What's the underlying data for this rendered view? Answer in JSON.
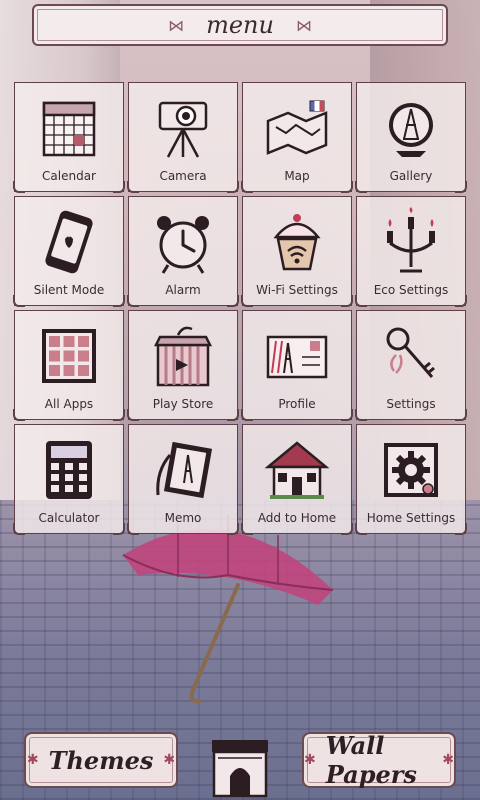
{
  "header": {
    "title": "menu",
    "left_icon": "bow-icon",
    "right_icon": "bow-icon"
  },
  "tiles": [
    {
      "label": "Calendar",
      "icon": "calendar-icon"
    },
    {
      "label": "Camera",
      "icon": "camera-icon"
    },
    {
      "label": "Map",
      "icon": "map-icon"
    },
    {
      "label": "Gallery",
      "icon": "gallery-icon"
    },
    {
      "label": "Silent Mode",
      "icon": "phone-icon"
    },
    {
      "label": "Alarm",
      "icon": "alarm-clock-icon"
    },
    {
      "label": "Wi-Fi Settings",
      "icon": "cupcake-wifi-icon"
    },
    {
      "label": "Eco Settings",
      "icon": "candelabra-icon"
    },
    {
      "label": "All Apps",
      "icon": "grid-icon"
    },
    {
      "label": "Play Store",
      "icon": "gift-box-icon"
    },
    {
      "label": "Profile",
      "icon": "postcard-icon"
    },
    {
      "label": "Settings",
      "icon": "key-icon"
    },
    {
      "label": "Calculator",
      "icon": "calculator-icon"
    },
    {
      "label": "Memo",
      "icon": "memo-icon"
    },
    {
      "label": "Add to Home",
      "icon": "house-icon"
    },
    {
      "label": "Home Settings",
      "icon": "gear-icon"
    }
  ],
  "footer": {
    "themes_label": "Themes",
    "wallpapers_label": "Wall Papers",
    "center_icon": "arc-de-triomphe-icon"
  },
  "colors": {
    "frame": "#5d4048",
    "tile_bg": "#f4ebec",
    "accent": "#a24a5c"
  }
}
